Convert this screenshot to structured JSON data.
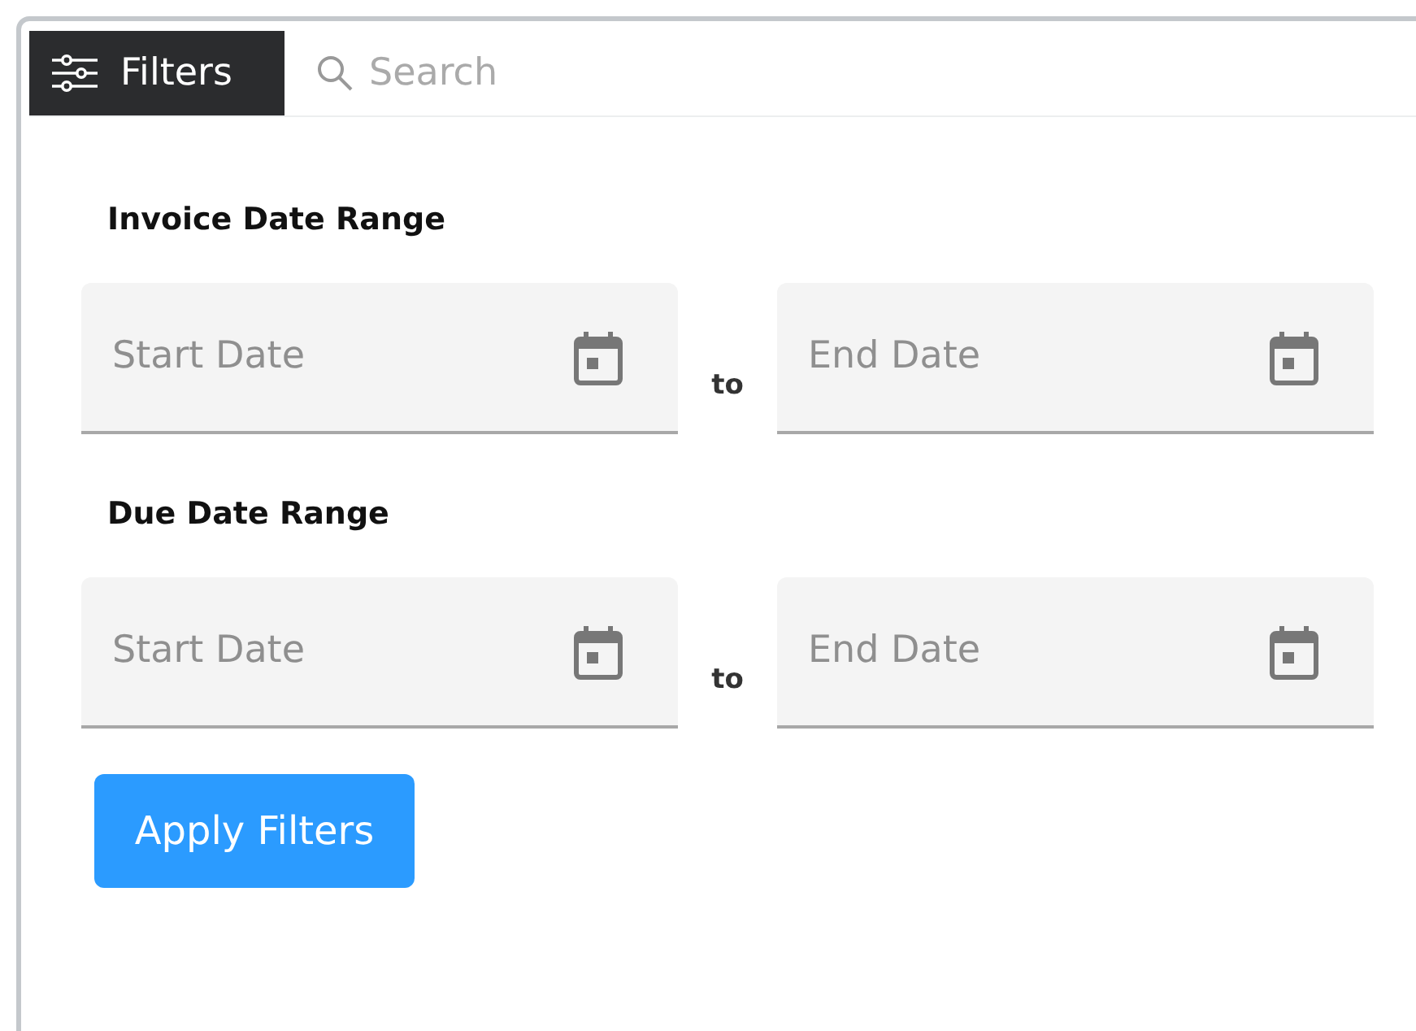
{
  "toolbar": {
    "filters_tab": {
      "label": "Filters",
      "selected": true
    },
    "search": {
      "placeholder": "Search"
    }
  },
  "sections": [
    {
      "title": "Invoice Date Range",
      "start": {
        "placeholder": "Start Date"
      },
      "separator": "to",
      "end": {
        "placeholder": "End Date"
      }
    },
    {
      "title": "Due Date Range",
      "start": {
        "placeholder": "Start Date"
      },
      "separator": "to",
      "end": {
        "placeholder": "End Date"
      }
    }
  ],
  "buttons": [
    {
      "label": "Apply Filters"
    }
  ]
}
